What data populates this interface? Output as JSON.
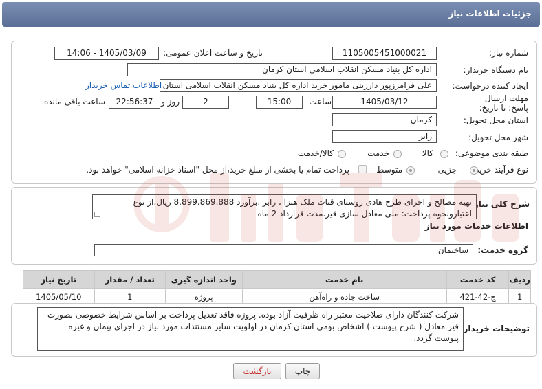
{
  "header": {
    "title": "جزئیات اطلاعات نیاز"
  },
  "fields": {
    "need_number_label": "شماره نیاز:",
    "need_number": "1105005451000021",
    "announce_label": "تاریخ و ساعت اعلان عمومی:",
    "announce_value": "1405/03/09 - 14:06",
    "buyer_label": "نام دستگاه خریدار:",
    "buyer_value": "اداره کل بنیاد مسکن انقلاب اسلامی استان کرمان",
    "creator_label": "ایجاد کننده درخواست:",
    "creator_value": "علی فرامرزپور دارزینی مامور خرید اداره کل بنیاد مسکن انقلاب اسلامی استان ک",
    "contact_link": "اطلاعات تماس خریدار",
    "deadline_label": "مهلت ارسال پاسخ: تا تاریخ:",
    "deadline_date": "1405/03/12",
    "time_label": "ساعت",
    "deadline_time": "15:00",
    "days_value": "2",
    "days_label": "روز و",
    "remaining_time": "22:56:37",
    "remaining_label": "ساعت باقی مانده",
    "province_label": "استان محل تحویل:",
    "province_value": "کرمان",
    "city_label": "شهر محل تحویل:",
    "city_value": "رابر",
    "category_label": "طبقه بندی موضوعی:",
    "category_options": [
      "کالا",
      "خدمت",
      "کالا/خدمت"
    ],
    "process_label": "نوع فرآیند خرید :",
    "process_options": [
      "جزیی",
      "متوسط"
    ],
    "payment_note": "پرداخت تمام یا بخشی از مبلغ خرید،از محل \"اسناد خزانه اسلامی\" خواهد بود."
  },
  "description": {
    "label": "شرح کلی نیاز:",
    "text": "تهیه مصالح و اجرای طرح هادی روستای قنات ملک هنزا ، رابر ،برآورد 8.899.869.888 ریال،از  نوع اعتبارونحوه پرداخت: ملی معادل سازی قیر.مدت قرارداد 2 ماه"
  },
  "services": {
    "section_title": "اطلاعات خدمات مورد نیاز",
    "group_label": "گروه خدمت:",
    "group_value": "ساختمان",
    "columns": [
      "ردیف",
      "کد خدمت",
      "نام خدمت",
      "واحد اندازه گیری",
      "تعداد / مقدار",
      "تاریخ نیاز"
    ],
    "rows": [
      [
        "1",
        "ج-42-421",
        "ساخت جاده و راه‌آهن",
        "پروژه",
        "1",
        "1405/05/10"
      ]
    ]
  },
  "buyer_notes": {
    "label": "توضیحات خریدار:",
    "text": "شرکت کنندگان دارای صلاحیت معتبر راه ظرفیت آزاد بوده. پروژه فاقد تعدیل پرداخت بر اساس شرایط خصوصی بصورت قیر معادل ( شرح پیوست ) اشخاص بومی استان کرمان در اولویت سایر مستندات مورد نیاز در اجرای پیمان و غیره پیوست گردد."
  },
  "buttons": {
    "print": "چاپ",
    "back": "بازگشت"
  },
  "colors": {
    "header": "#6b7fa6",
    "back_text": "#c62828",
    "link": "#1a5fb4"
  }
}
